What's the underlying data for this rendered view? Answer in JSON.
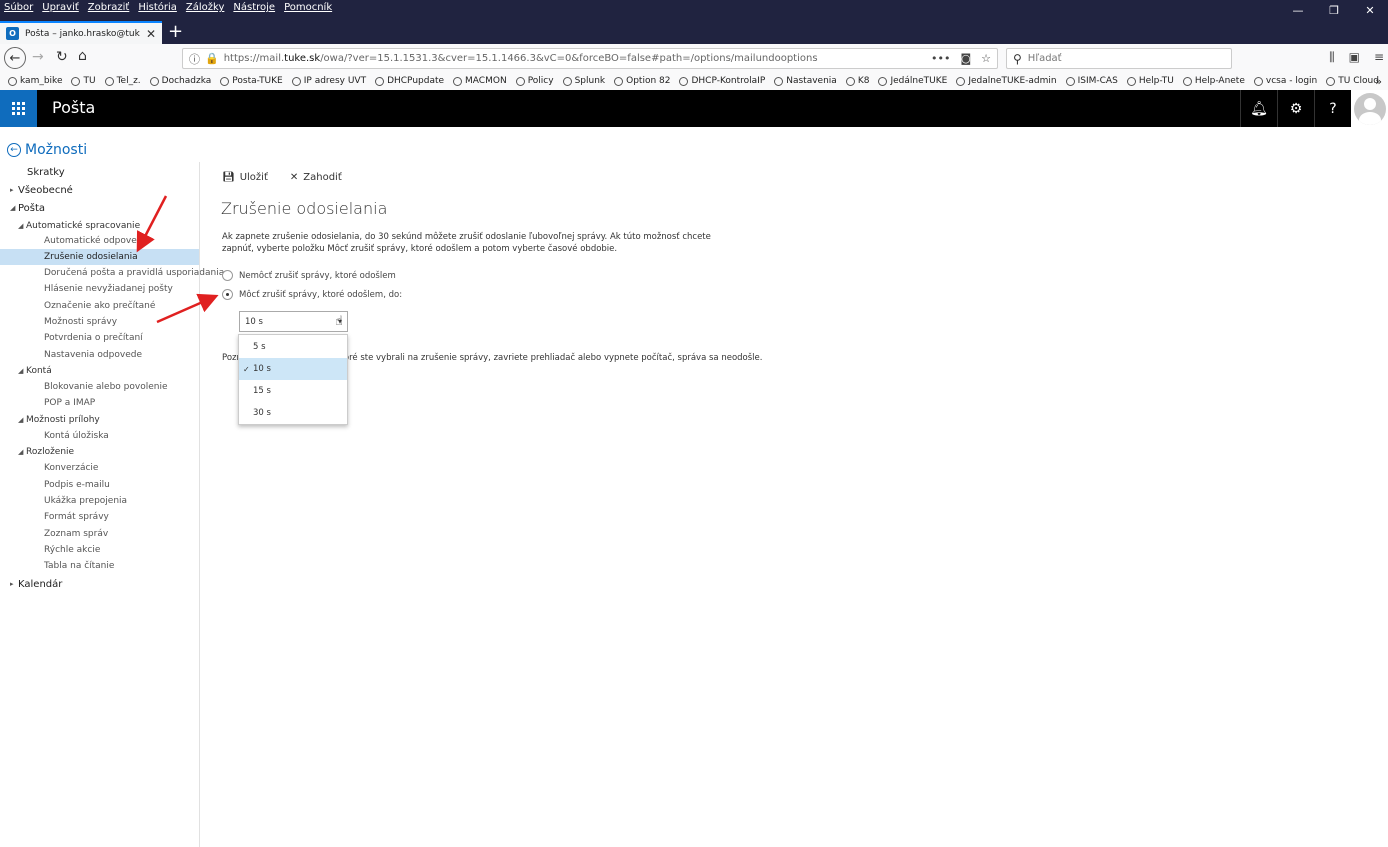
{
  "browser": {
    "menu": [
      "Súbor",
      "Upraviť",
      "Zobraziť",
      "História",
      "Záložky",
      "Nástroje",
      "Pomocník"
    ],
    "tab_title": "Pošta – janko.hrasko@tuke.sk",
    "url_prefix": "https://mail.",
    "url_domain": "tuke.sk",
    "url_rest": "/owa/?ver=15.1.1531.3&cver=15.1.1466.3&vC=0&forceBO=false#path=/options/mailundooptions",
    "search_placeholder": "Hľadať",
    "bookmarks": [
      "kam_bike",
      "TU",
      "Tel_z.",
      "Dochadzka",
      "Posta-TUKE",
      "IP adresy UVT",
      "DHCPupdate",
      "MACMON",
      "Policy",
      "Splunk",
      "Option 82",
      "DHCP-KontrolaIP",
      "Nastavenia",
      "K8",
      "JedálneTUKE",
      "JedalneTUKE-admin",
      "ISIM-CAS",
      "Help-TU",
      "Help-Anete",
      "vcsa - login",
      "TU Cloud"
    ]
  },
  "app": {
    "title": "Pošta"
  },
  "options": {
    "title": "Možnosti",
    "sidebar": [
      {
        "label": "Skratky",
        "level": 1,
        "arrow": ""
      },
      {
        "label": "Všeobecné",
        "level": 1,
        "arrow": "▸"
      },
      {
        "label": "Pošta",
        "level": 1,
        "arrow": "◢"
      },
      {
        "label": "Automatické spracovanie",
        "level": 2,
        "arrow": "◢"
      },
      {
        "label": "Automatické odpovede",
        "level": 3,
        "arrow": ""
      },
      {
        "label": "Zrušenie odosielania",
        "level": 3,
        "arrow": "",
        "selected": true
      },
      {
        "label": "Doručená pošta a pravidlá usporiadania",
        "level": 3,
        "arrow": ""
      },
      {
        "label": "Hlásenie nevyžiadanej pošty",
        "level": 3,
        "arrow": ""
      },
      {
        "label": "Označenie ako prečítané",
        "level": 3,
        "arrow": ""
      },
      {
        "label": "Možnosti správy",
        "level": 3,
        "arrow": ""
      },
      {
        "label": "Potvrdenia o prečítaní",
        "level": 3,
        "arrow": ""
      },
      {
        "label": "Nastavenia odpovede",
        "level": 3,
        "arrow": ""
      },
      {
        "label": "Kontá",
        "level": 2,
        "arrow": "◢"
      },
      {
        "label": "Blokovanie alebo povolenie",
        "level": 3,
        "arrow": ""
      },
      {
        "label": "POP a IMAP",
        "level": 3,
        "arrow": ""
      },
      {
        "label": "Možnosti prílohy",
        "level": 2,
        "arrow": "◢"
      },
      {
        "label": "Kontá úložiska",
        "level": 3,
        "arrow": ""
      },
      {
        "label": "Rozloženie",
        "level": 2,
        "arrow": "◢"
      },
      {
        "label": "Konverzácie",
        "level": 3,
        "arrow": ""
      },
      {
        "label": "Podpis e-mailu",
        "level": 3,
        "arrow": ""
      },
      {
        "label": "Ukážka prepojenia",
        "level": 3,
        "arrow": ""
      },
      {
        "label": "Formát správy",
        "level": 3,
        "arrow": ""
      },
      {
        "label": "Zoznam správ",
        "level": 3,
        "arrow": ""
      },
      {
        "label": "Rýchle akcie",
        "level": 3,
        "arrow": ""
      },
      {
        "label": "Tabla na čítanie",
        "level": 3,
        "arrow": ""
      },
      {
        "label": "Kalendár",
        "level": 1,
        "arrow": "▸"
      }
    ]
  },
  "content": {
    "save_label": "Uložiť",
    "discard_label": "Zahodiť",
    "page_title": "Zrušenie odosielania",
    "description": "Ak zapnete zrušenie odosielania, do 30 sekúnd môžete zrušiť odoslanie ľubovoľnej správy. Ak túto možnosť chcete zapnúť, vyberte položku Môcť zrušiť správy, ktoré odošlem a potom vyberte časové obdobie.",
    "option_off": "Nemôcť zrušiť správy, ktoré odošlem",
    "option_on": "Môcť zrušiť správy, ktoré odošlem, do:",
    "selected_value": "10 s",
    "dropdown_options": [
      "5 s",
      "10 s",
      "15 s",
      "30 s"
    ],
    "note_start": "Pozn",
    "note_end": "oré ste vybrali na zrušenie správy, zavriete prehliadač alebo vypnete počítač, správa sa neodošle."
  },
  "colors": {
    "accent": "#0f6cbd",
    "selection": "#c7e0f4",
    "annotation_arrow": "#e02020"
  }
}
